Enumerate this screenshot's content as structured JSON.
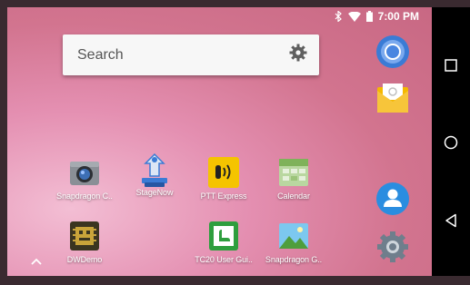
{
  "status_bar": {
    "time": "7:00 PM",
    "icons": [
      "bluetooth-icon",
      "wifi-icon",
      "battery-icon"
    ]
  },
  "search": {
    "placeholder": "Search",
    "icon": "gear-icon"
  },
  "apps": [
    {
      "label": "Snapdragon C..",
      "icon": "camera-icon"
    },
    {
      "label": "StageNow",
      "icon": "stagenow-icon"
    },
    {
      "label": "PTT Express",
      "icon": "ptt-icon"
    },
    {
      "label": "Calendar",
      "icon": "calendar-icon"
    },
    {
      "label": "DWDemo",
      "icon": "dwdemo-icon"
    },
    {
      "label": "TC20 User Gui..",
      "icon": "user-guide-icon"
    },
    {
      "label": "Snapdragon G..",
      "icon": "gallery-icon"
    }
  ],
  "dock": [
    "chrome-icon",
    "email-icon",
    "contacts-icon",
    "settings-icon"
  ],
  "nav": [
    "recents-button",
    "home-button",
    "back-button"
  ],
  "colors": {
    "wallpaper": "#d87a98",
    "ptt": "#f5c400",
    "stagenow": "#3a7bd5",
    "guide": "#2e9e3e",
    "contacts": "#2a8de0"
  }
}
